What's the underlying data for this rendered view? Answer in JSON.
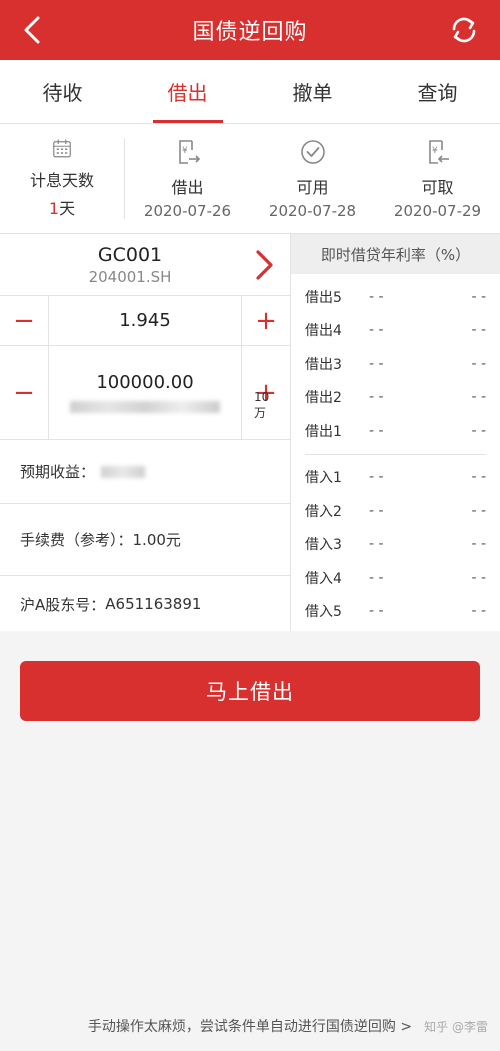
{
  "header": {
    "title": "国债逆回购"
  },
  "tabs": [
    {
      "label": "待收"
    },
    {
      "label": "借出"
    },
    {
      "label": "撤单"
    },
    {
      "label": "查询"
    }
  ],
  "dates": {
    "interest_days_label": "计息天数",
    "interest_days_num": "1",
    "interest_days_unit": "天",
    "cols": [
      {
        "label": "借出",
        "date": "2020-07-26"
      },
      {
        "label": "可用",
        "date": "2020-07-28"
      },
      {
        "label": "可取",
        "date": "2020-07-29"
      }
    ]
  },
  "product": {
    "code": "GC001",
    "market_code": "204001.SH"
  },
  "price": {
    "value": "1.945"
  },
  "amount": {
    "value": "100000.00",
    "unit_label": "10万"
  },
  "info": {
    "expected_income_label": "预期收益：",
    "fee_label": "手续费（参考）：",
    "fee_value": "1.00元",
    "account_label": "沪A股东号：",
    "account_value": "A651163891"
  },
  "rates": {
    "header": "即时借贷年利率（%）",
    "lend": [
      {
        "name": "借出5",
        "v1": "- -",
        "v2": "- -"
      },
      {
        "name": "借出4",
        "v1": "- -",
        "v2": "- -"
      },
      {
        "name": "借出3",
        "v1": "- -",
        "v2": "- -"
      },
      {
        "name": "借出2",
        "v1": "- -",
        "v2": "- -"
      },
      {
        "name": "借出1",
        "v1": "- -",
        "v2": "- -"
      }
    ],
    "borrow": [
      {
        "name": "借入1",
        "v1": "- -",
        "v2": "- -"
      },
      {
        "name": "借入2",
        "v1": "- -",
        "v2": "- -"
      },
      {
        "name": "借入3",
        "v1": "- -",
        "v2": "- -"
      },
      {
        "name": "借入4",
        "v1": "- -",
        "v2": "- -"
      },
      {
        "name": "借入5",
        "v1": "- -",
        "v2": "- -"
      }
    ]
  },
  "action": {
    "submit_label": "马上借出"
  },
  "footer": {
    "link_text": "手动操作太麻烦，尝试条件单自动进行国债逆回购 >",
    "watermark": "知乎 @李雷"
  },
  "colors": {
    "accent": "#d8302f",
    "background": "#f4f4f4"
  },
  "icons": [
    "back-arrow-icon",
    "refresh-icon",
    "calendar-icon",
    "yuan-out-icon",
    "check-circle-icon",
    "yuan-in-icon",
    "chevron-right-icon"
  ]
}
